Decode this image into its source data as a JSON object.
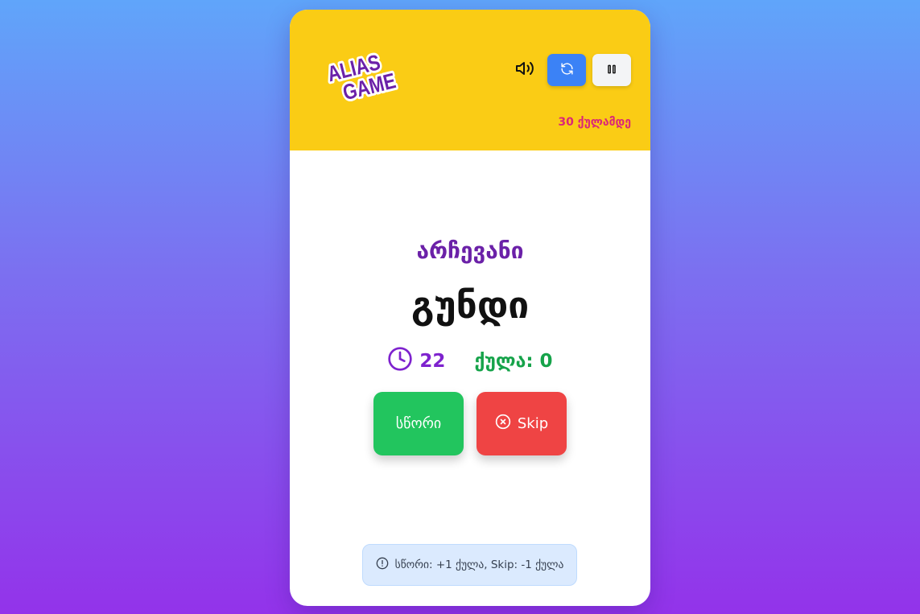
{
  "logo": {
    "line1": "ALIAS",
    "line2": "GAME"
  },
  "header": {
    "target_text": "30 ქულამდე",
    "icons": {
      "sound": "volume-icon",
      "refresh": "refresh-icon",
      "pause": "pause-icon"
    }
  },
  "game": {
    "category": "არჩევანი",
    "word": "გუნდი",
    "timer_value": "22",
    "score_text": "ქულა: 0"
  },
  "buttons": {
    "correct_label": "სწორი",
    "skip_label": "Skip"
  },
  "info": {
    "text": "სწორი: +1 ქულა, Skip: -1 ქულა"
  },
  "colors": {
    "header_bg": "#facc15",
    "accent_blue": "#3b82f6",
    "correct_green": "#22c55e",
    "skip_red": "#ef4444",
    "category_purple": "#6b21a8",
    "target_pink": "#db2777"
  }
}
